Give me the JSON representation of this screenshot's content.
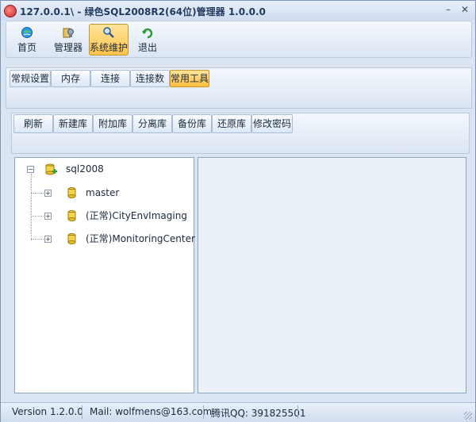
{
  "window": {
    "title": "127.0.0.1\\ - 绿色SQL2008R2(64位)管理器 1.0.0.0",
    "min_glyph": "–",
    "close_glyph": "✕"
  },
  "toolbar": {
    "buttons": [
      {
        "label": "首页",
        "icon": "home-icon"
      },
      {
        "label": "管理器",
        "icon": "manager-icon"
      },
      {
        "label": "系统维护",
        "icon": "maintenance-icon",
        "active": true
      },
      {
        "label": "退出",
        "icon": "exit-icon"
      }
    ]
  },
  "tabs": [
    {
      "label": "常规设置"
    },
    {
      "label": "内存"
    },
    {
      "label": "连接"
    },
    {
      "label": "连接数"
    },
    {
      "label": "常用工具",
      "active": true
    }
  ],
  "actions": [
    {
      "label": "刷新"
    },
    {
      "label": "新建库"
    },
    {
      "label": "附加库"
    },
    {
      "label": "分离库"
    },
    {
      "label": "备份库"
    },
    {
      "label": "还原库"
    },
    {
      "label": "修改密码"
    }
  ],
  "tree": {
    "root": {
      "label": "sql2008",
      "expanded": true
    },
    "children": [
      {
        "label": "master"
      },
      {
        "label": "(正常)CityEnvImaging"
      },
      {
        "label": "(正常)MonitoringCenter"
      }
    ]
  },
  "status": {
    "version": "Version 1.2.0.0",
    "mail": "Mail: wolfmens@163.com",
    "qq": "腾讯QQ: 391825501"
  },
  "colors": {
    "active_button": "#ffc44a",
    "panel_bg": "#dbe5f2",
    "border": "#8ea4c3"
  }
}
